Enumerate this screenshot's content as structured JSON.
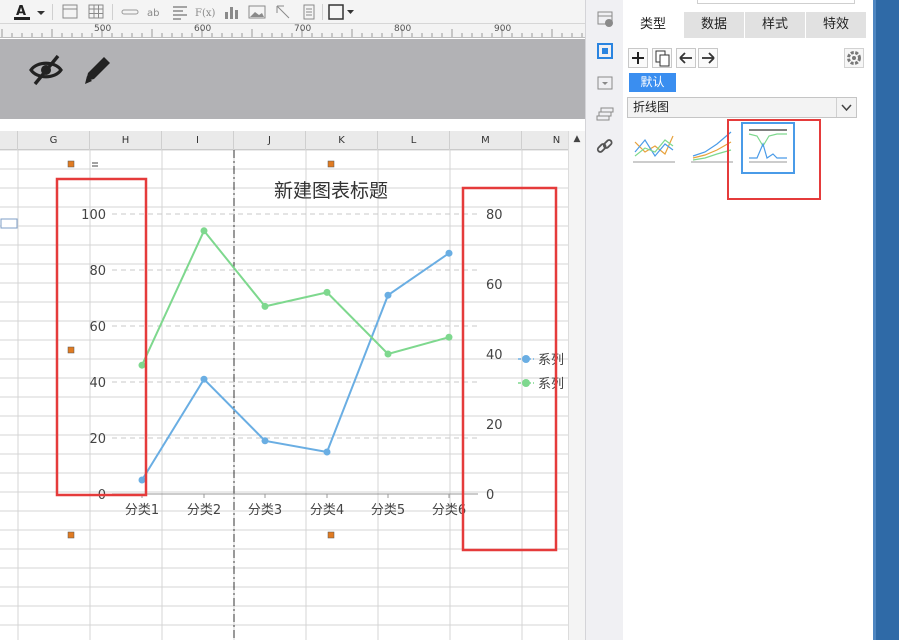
{
  "toolbar": {
    "font_color_letter": "A",
    "icons": [
      "font-color-icon",
      "dropdown-arrow-icon",
      "merge-cells-icon",
      "table-icon",
      "link-icon",
      "ab-text-icon",
      "align-icon",
      "formula-icon",
      "chart-icon",
      "image-icon",
      "pointer-icon",
      "document-icon",
      "border-icon"
    ],
    "ab_label": "ab",
    "formula_label": "F(x)"
  },
  "ruler": {
    "labels": [
      "500",
      "600",
      "700",
      "800",
      "900"
    ]
  },
  "sheet": {
    "columns": [
      "G",
      "H",
      "I",
      "J",
      "K",
      "L",
      "M",
      "N"
    ]
  },
  "chart_data": {
    "type": "line",
    "title": "新建图表标题",
    "categories": [
      "分类1",
      "分类2",
      "分类3",
      "分类4",
      "分类5",
      "分类6"
    ],
    "series": [
      {
        "name": "系列",
        "color": "#6aaee3",
        "values": [
          5,
          41,
          19,
          15,
          71,
          86
        ],
        "axis": "left"
      },
      {
        "name": "系列",
        "color": "#7ed88e",
        "values": [
          46,
          94,
          67,
          72,
          50,
          56
        ],
        "axis": "left"
      }
    ],
    "y_left": {
      "ylim": [
        0,
        100
      ],
      "ticks": [
        "0",
        "20",
        "40",
        "60",
        "80",
        "100"
      ]
    },
    "y_right": {
      "ylim": [
        0,
        80
      ],
      "ticks": [
        "0",
        "20",
        "40",
        "60",
        "80"
      ]
    },
    "grid": true,
    "legend": "right",
    "marker_color": "#e07b22"
  },
  "side": {
    "icons": [
      "cell-properties-icon",
      "chart-properties-icon",
      "dropdown-widget-icon",
      "stacked-form-icon",
      "hyperlink-icon"
    ]
  },
  "panel": {
    "tabs": [
      "类型",
      "数据",
      "样式",
      "特效"
    ],
    "active_tab": "类型",
    "buttons": [
      "add-icon",
      "copy-icon",
      "arrow-left-icon",
      "arrow-right-icon",
      "gear-icon"
    ],
    "default_label": "默认",
    "type_select_value": "折线图",
    "thumbnails": [
      "line-chart-thumb",
      "area-line-chart-thumb",
      "range-line-chart-thumb"
    ]
  },
  "colors": {
    "accent": "#3a8ef0",
    "highlight_red": "#e53b3b",
    "edge_blue": "#2f6aa7"
  }
}
